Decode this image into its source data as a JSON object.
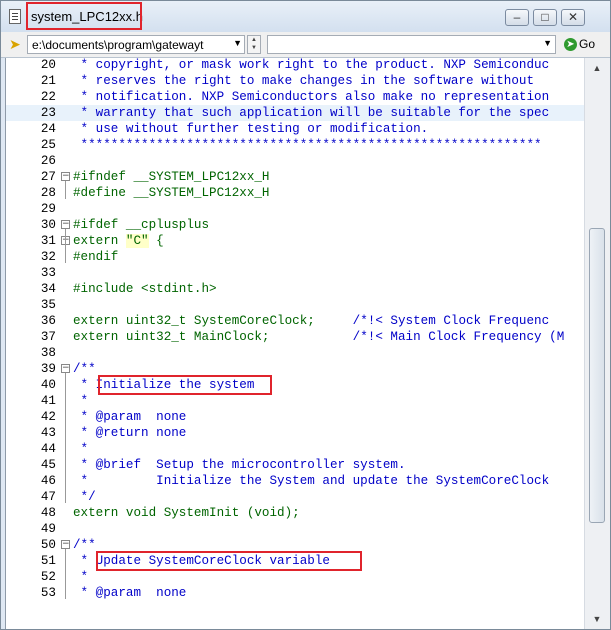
{
  "window": {
    "title": "system_LPC12xx.h"
  },
  "toolbar": {
    "path": "e:\\documents\\program\\gatewayt",
    "search_value": "",
    "go_label": "Go"
  },
  "lines": [
    {
      "n": "20",
      "t": " * copyright, or mask work right to the product. NXP Semiconduc"
    },
    {
      "n": "21",
      "t": " * reserves the right to make changes in the software without"
    },
    {
      "n": "22",
      "t": " * notification. NXP Semiconductors also make no representation"
    },
    {
      "n": "23",
      "t": " * warranty that such application will be suitable for the spec"
    },
    {
      "n": "24",
      "t": " * use without further testing or modification."
    },
    {
      "n": "25",
      "t": " *************************************************************"
    },
    {
      "n": "26",
      "t": ""
    },
    {
      "n": "27",
      "t": "#ifndef __SYSTEM_LPC12xx_H"
    },
    {
      "n": "28",
      "t": "#define __SYSTEM_LPC12xx_H"
    },
    {
      "n": "29",
      "t": ""
    },
    {
      "n": "30",
      "t": "#ifdef __cplusplus"
    },
    {
      "n": "31",
      "t": "extern \"C\" {"
    },
    {
      "n": "32",
      "t": "#endif"
    },
    {
      "n": "33",
      "t": ""
    },
    {
      "n": "34",
      "t": "#include <stdint.h>"
    },
    {
      "n": "35",
      "t": ""
    },
    {
      "n": "36",
      "t": "extern uint32_t SystemCoreClock;     /*!< System Clock Frequenc"
    },
    {
      "n": "37",
      "t": "extern uint32_t MainClock;           /*!< Main Clock Frequency (M"
    },
    {
      "n": "38",
      "t": ""
    },
    {
      "n": "39",
      "t": "/**"
    },
    {
      "n": "40",
      "t": " * Initialize the system"
    },
    {
      "n": "41",
      "t": " *"
    },
    {
      "n": "42",
      "t": " * @param  none"
    },
    {
      "n": "43",
      "t": " * @return none"
    },
    {
      "n": "44",
      "t": " *"
    },
    {
      "n": "45",
      "t": " * @brief  Setup the microcontroller system."
    },
    {
      "n": "46",
      "t": " *         Initialize the System and update the SystemCoreClock"
    },
    {
      "n": "47",
      "t": " */"
    },
    {
      "n": "48",
      "t": "extern void SystemInit (void);"
    },
    {
      "n": "49",
      "t": ""
    },
    {
      "n": "50",
      "t": "/**"
    },
    {
      "n": "51",
      "t": " * Update SystemCoreClock variable"
    },
    {
      "n": "52",
      "t": " *"
    },
    {
      "n": "53",
      "t": " * @param  none"
    }
  ]
}
